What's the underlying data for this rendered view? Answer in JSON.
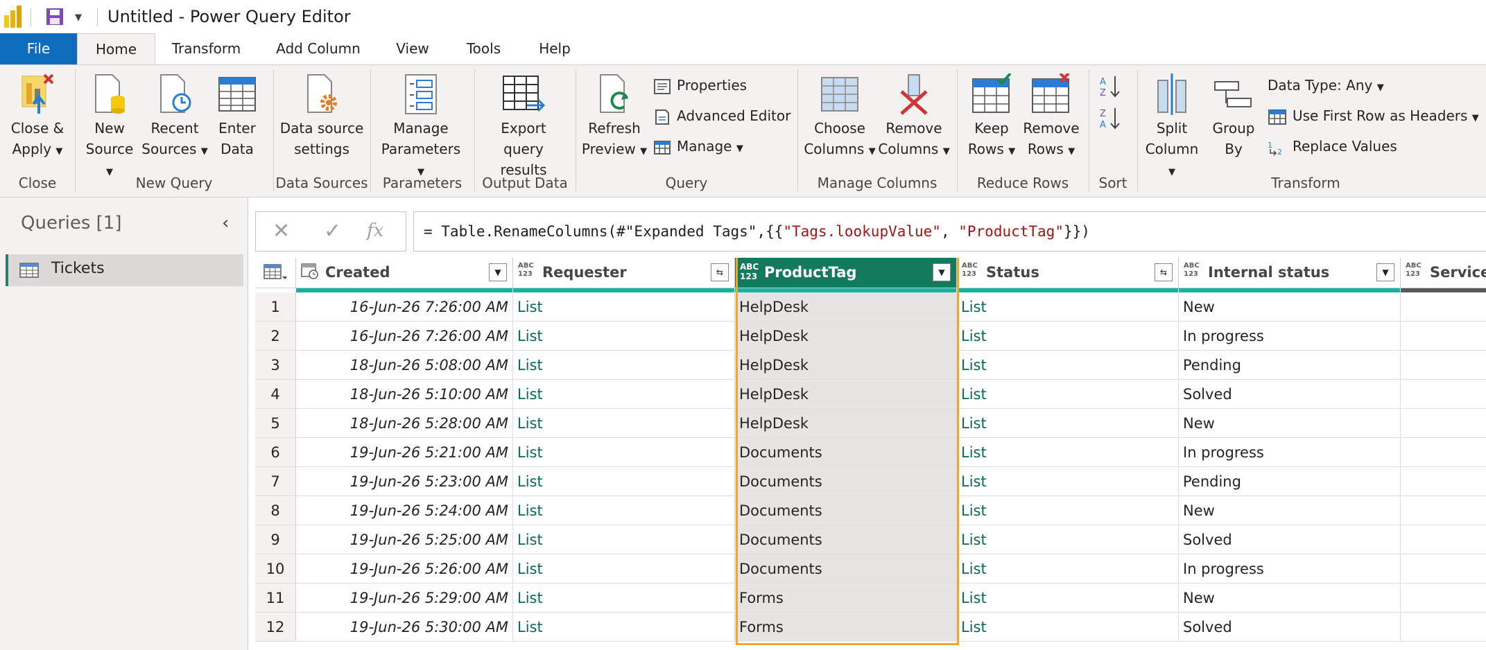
{
  "window": {
    "title": "Untitled - Power Query Editor"
  },
  "menu_tabs": [
    "File",
    "Home",
    "Transform",
    "Add Column",
    "View",
    "Tools",
    "Help"
  ],
  "ribbon": {
    "close_apply": [
      "Close &",
      "Apply"
    ],
    "new_source": [
      "New",
      "Source"
    ],
    "recent_sources": [
      "Recent",
      "Sources"
    ],
    "enter_data": [
      "Enter",
      "Data"
    ],
    "data_source_settings": [
      "Data source",
      "settings"
    ],
    "manage_parameters": [
      "Manage",
      "Parameters"
    ],
    "export_query": [
      "Export query",
      "results"
    ],
    "refresh_preview": [
      "Refresh",
      "Preview"
    ],
    "properties": "Properties",
    "advanced_editor": "Advanced Editor",
    "manage": "Manage",
    "choose_columns": [
      "Choose",
      "Columns"
    ],
    "remove_columns": [
      "Remove",
      "Columns"
    ],
    "keep_rows": [
      "Keep",
      "Rows"
    ],
    "remove_rows": [
      "Remove",
      "Rows"
    ],
    "split_column": [
      "Split",
      "Column"
    ],
    "group_by": [
      "Group",
      "By"
    ],
    "data_type": "Data Type: Any",
    "first_row_headers": "Use First Row as Headers",
    "replace_values": "Replace Values",
    "groups": {
      "close": "Close",
      "new_query": "New Query",
      "data_sources": "Data Sources",
      "parameters": "Parameters",
      "output_data": "Output Data",
      "query": "Query",
      "manage_columns": "Manage Columns",
      "reduce_rows": "Reduce Rows",
      "sort": "Sort",
      "transform": "Transform"
    }
  },
  "queries_pane": {
    "title": "Queries [1]",
    "items": [
      "Tickets"
    ]
  },
  "formula": {
    "prefix": "= Table.RenameColumns(#\"Expanded Tags\",{{",
    "str1": "\"Tags.lookupValue\"",
    "mid": ", ",
    "str2": "\"ProductTag\"",
    "suffix": "}})"
  },
  "table": {
    "columns": [
      {
        "name": "Created",
        "type": "date"
      },
      {
        "name": "Requester",
        "type": "ABC\n123"
      },
      {
        "name": "ProductTag",
        "type": "ABC\n123",
        "selected": true
      },
      {
        "name": "Status",
        "type": "ABC\n123"
      },
      {
        "name": "Internal status",
        "type": "ABC\n123"
      },
      {
        "name": "Service",
        "type": "ABC\n123"
      }
    ],
    "rows": [
      {
        "n": "1",
        "created": "16-Jun-26 7:26:00 AM",
        "requester": "List",
        "product": "HelpDesk",
        "status": "List",
        "internal": "New"
      },
      {
        "n": "2",
        "created": "16-Jun-26 7:26:00 AM",
        "requester": "List",
        "product": "HelpDesk",
        "status": "List",
        "internal": "In progress"
      },
      {
        "n": "3",
        "created": "18-Jun-26 5:08:00 AM",
        "requester": "List",
        "product": "HelpDesk",
        "status": "List",
        "internal": "Pending"
      },
      {
        "n": "4",
        "created": "18-Jun-26 5:10:00 AM",
        "requester": "List",
        "product": "HelpDesk",
        "status": "List",
        "internal": "Solved"
      },
      {
        "n": "5",
        "created": "18-Jun-26 5:28:00 AM",
        "requester": "List",
        "product": "HelpDesk",
        "status": "List",
        "internal": "New"
      },
      {
        "n": "6",
        "created": "19-Jun-26 5:21:00 AM",
        "requester": "List",
        "product": "Documents",
        "status": "List",
        "internal": "In progress"
      },
      {
        "n": "7",
        "created": "19-Jun-26 5:23:00 AM",
        "requester": "List",
        "product": "Documents",
        "status": "List",
        "internal": "Pending"
      },
      {
        "n": "8",
        "created": "19-Jun-26 5:24:00 AM",
        "requester": "List",
        "product": "Documents",
        "status": "List",
        "internal": "New"
      },
      {
        "n": "9",
        "created": "19-Jun-26 5:25:00 AM",
        "requester": "List",
        "product": "Documents",
        "status": "List",
        "internal": "Solved"
      },
      {
        "n": "10",
        "created": "19-Jun-26 5:26:00 AM",
        "requester": "List",
        "product": "Documents",
        "status": "List",
        "internal": "In progress"
      },
      {
        "n": "11",
        "created": "19-Jun-26 5:29:00 AM",
        "requester": "List",
        "product": "Forms",
        "status": "List",
        "internal": "New"
      },
      {
        "n": "12",
        "created": "19-Jun-26 5:30:00 AM",
        "requester": "List",
        "product": "Forms",
        "status": "List",
        "internal": "Solved"
      }
    ]
  },
  "colors": {
    "accent": "#0f6cbd",
    "selected_header": "#137a5e",
    "selection_border": "#f2a825",
    "link": "#0b6a53",
    "quality_bar": "#15b4a0"
  }
}
